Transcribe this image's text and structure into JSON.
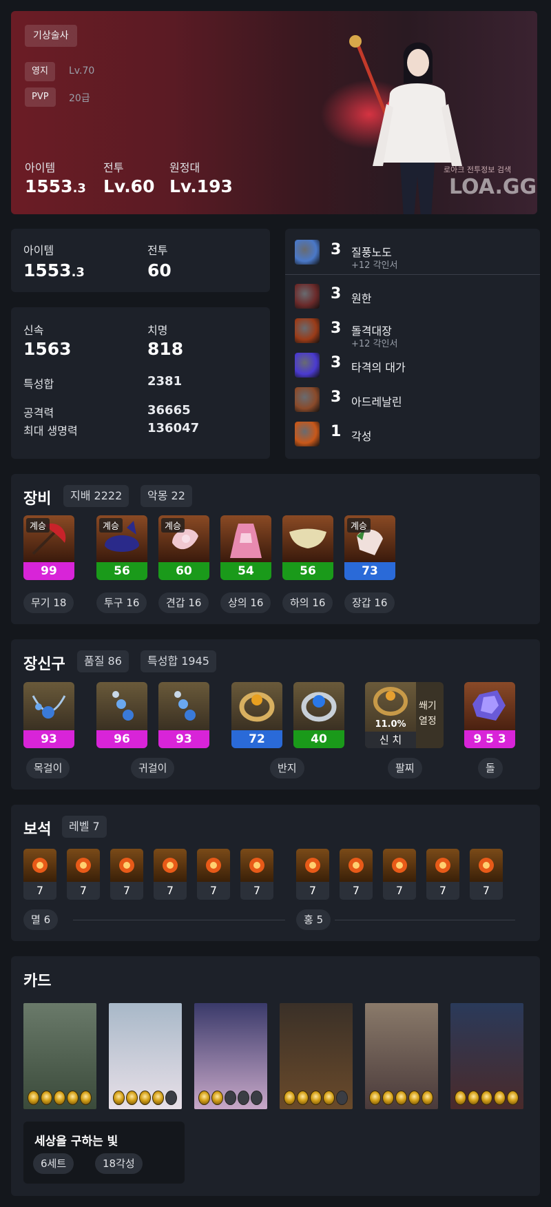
{
  "profile": {
    "class": "기상술사",
    "estate_label": "영지",
    "estate_value": "Lv.70",
    "pvp_label": "PVP",
    "pvp_value": "20급",
    "item_label": "아이템",
    "item_value": "1553",
    "item_decimal": ".3",
    "combat_label": "전투",
    "combat_value": "Lv.60",
    "expedition_label": "원정대",
    "expedition_value": "Lv.193",
    "watermark_sub": "로아크 전투정보 검색",
    "watermark": "LOA.GG"
  },
  "levels": {
    "item_label": "아이템",
    "item_value": "1553",
    "item_decimal": ".3",
    "combat_label": "전투",
    "combat_value": "60"
  },
  "stats": {
    "speed_label": "신속",
    "speed_value": "1563",
    "crit_label": "치명",
    "crit_value": "818",
    "total_label": "특성합",
    "total_value": "2381",
    "atk_label": "공격력",
    "atk_value": "36665",
    "hp_label": "최대 생명력",
    "hp_value": "136047"
  },
  "engravings": [
    {
      "level": "3",
      "name": "질풍노도",
      "sub": "+12 각인서",
      "icon": "wind-swirl-icon",
      "color": "#4a78c8"
    },
    {
      "level": "3",
      "name": "원한",
      "sub": "",
      "icon": "demon-head-icon",
      "color": "#6b2a2a"
    },
    {
      "level": "3",
      "name": "돌격대장",
      "sub": "+12 각인서",
      "icon": "charging-warrior-icon",
      "color": "#9a3b18"
    },
    {
      "level": "3",
      "name": "타격의 대가",
      "sub": "",
      "icon": "lightning-strike-icon",
      "color": "#4a3ad0"
    },
    {
      "level": "3",
      "name": "아드레날린",
      "sub": "",
      "icon": "rage-figure-icon",
      "color": "#8a4a2a"
    },
    {
      "level": "1",
      "name": "각성",
      "sub": "",
      "icon": "awakened-face-icon",
      "color": "#c8581a"
    }
  ],
  "equipment": {
    "title": "장비",
    "tag1": "지배 2222",
    "tag2": "악몽 22",
    "items": [
      {
        "badge": "계승",
        "quality": "99",
        "color": "#d824d8",
        "slot": "무기 18",
        "icon": "umbrella-weapon-icon"
      },
      {
        "badge": "계승",
        "quality": "56",
        "color": "#1a9a1a",
        "slot": "투구 16",
        "icon": "cat-hat-icon"
      },
      {
        "badge": "계승",
        "quality": "60",
        "color": "#1a9a1a",
        "slot": "견갑 16",
        "icon": "flower-pauldron-icon"
      },
      {
        "badge": "",
        "quality": "54",
        "color": "#1a9a1a",
        "slot": "상의 16",
        "icon": "pink-dress-icon"
      },
      {
        "badge": "",
        "quality": "56",
        "color": "#1a9a1a",
        "slot": "하의 16",
        "icon": "skirt-icon"
      },
      {
        "badge": "계승",
        "quality": "73",
        "color": "#2a6ad8",
        "slot": "장갑 16",
        "icon": "glove-icon"
      }
    ]
  },
  "accessories": {
    "title": "장신구",
    "tag1": "품질 86",
    "tag2": "특성합 1945",
    "items": [
      {
        "quality": "93",
        "color": "#d824d8",
        "icon": "necklace-icon"
      },
      {
        "quality": "96",
        "color": "#d824d8",
        "icon": "earring-icon"
      },
      {
        "quality": "93",
        "color": "#d824d8",
        "icon": "earring-icon"
      },
      {
        "quality": "72",
        "color": "#2a6ad8",
        "icon": "ring-gold-icon"
      },
      {
        "quality": "40",
        "color": "#1a9a1a",
        "icon": "ring-blue-icon"
      }
    ],
    "bracelet": {
      "percent": "11.0%",
      "stat": "신 치",
      "side1": "쐐기",
      "side2": "열정"
    },
    "stone": {
      "value": "9 5 3"
    },
    "labels": {
      "necklace": "목걸이",
      "earrings": "귀걸이",
      "rings": "반지",
      "bracelet": "팔찌",
      "stone": "돌"
    }
  },
  "gems": {
    "title": "보석",
    "tag": "레벨 7",
    "left": [
      "7",
      "7",
      "7",
      "7",
      "7",
      "7"
    ],
    "right": [
      "7",
      "7",
      "7",
      "7",
      "7"
    ],
    "left_label": "멸 6",
    "right_label": "홍 5"
  },
  "cards": {
    "title": "카드",
    "set_name": "세상을 구하는 빛",
    "set_count": "6세트",
    "awaken": "18각성",
    "items": [
      {
        "name": "elf-card",
        "awakened": 5
      },
      {
        "name": "angel-card",
        "awakened": 4
      },
      {
        "name": "twin-card",
        "awakened": 2
      },
      {
        "name": "warrior-card",
        "awakened": 4
      },
      {
        "name": "knight-card",
        "awakened": 5
      },
      {
        "name": "hero-card",
        "awakened": 5
      }
    ]
  }
}
